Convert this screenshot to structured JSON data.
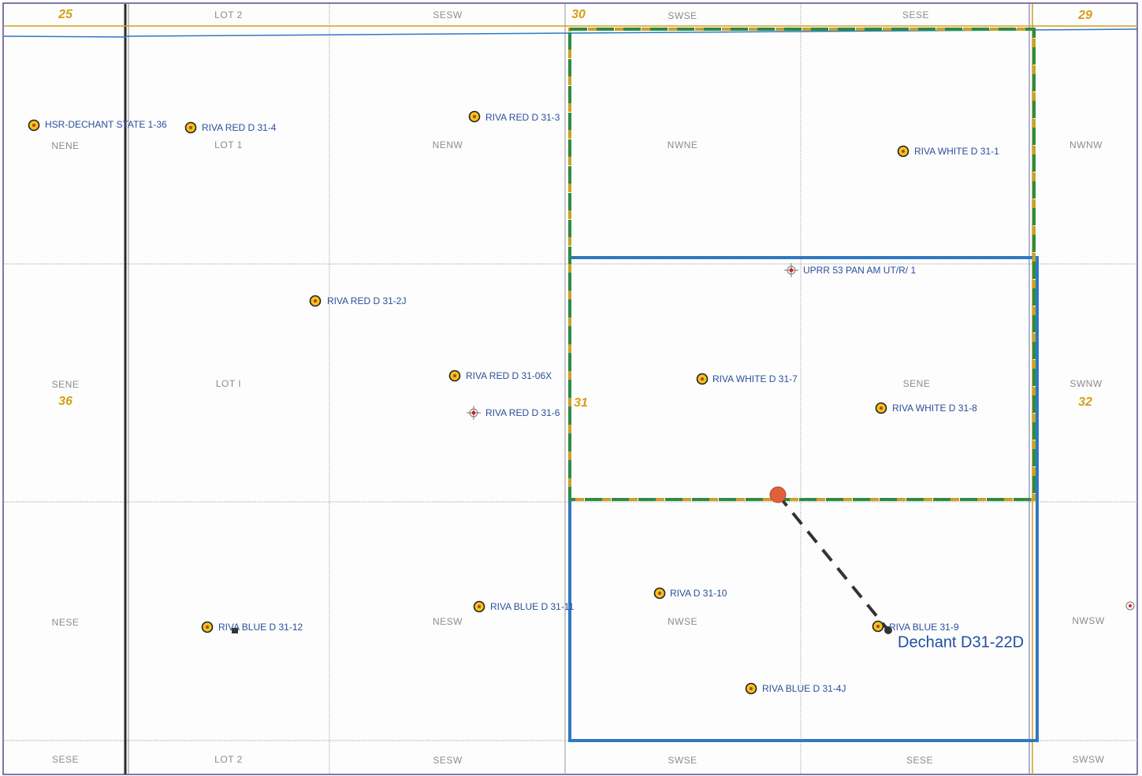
{
  "quarter_labels": {
    "sec25_nene": "NENE",
    "sec25_sene": "SENE",
    "sec25_nese": "NESE",
    "sec25_sese": "SESE",
    "col2_top": "LOT 2",
    "col2_r1": "LOT 1",
    "col2_r2": "LOT I",
    "col2_bottom": "LOT 2",
    "col3_top": "SESW",
    "col3_r1": "NENW",
    "col3_r3": "NESW",
    "col3_bottom": "SESW",
    "col4_top": "SWSE",
    "col4_r1": "NWNE",
    "col4_r3": "NWSE",
    "col4_bottom": "SWSE",
    "col5_top": "SESE",
    "col5_r2": "SENE",
    "col5_bottom": "SESE",
    "sec32_r1": "NWNW",
    "sec32_r2": "SWNW",
    "sec32_r3": "NWSW",
    "sec32_bottom": "SWSW"
  },
  "section_numbers": {
    "s25": "25",
    "s30": "30",
    "s29": "29",
    "s36": "36",
    "s31": "31",
    "s32": "32"
  },
  "wells": {
    "hsr_dechant": "HSR-DECHANT STATE 1-36",
    "riva_red_31_4": "RIVA RED D 31-4",
    "riva_red_31_3": "RIVA RED D 31-3",
    "riva_white_31_1": "RIVA WHITE D 31-1",
    "uprr_53": "UPRR 53 PAN AM UT/R/ 1",
    "riva_red_31_2j": "RIVA RED D 31-2J",
    "riva_red_31_06x": "RIVA RED D 31-06X",
    "riva_red_31_6": "RIVA RED D 31-6",
    "riva_white_31_7": "RIVA WHITE D 31-7",
    "riva_white_31_8": "RIVA WHITE D 31-8",
    "riva_d_31_10": "RIVA D 31-10",
    "riva_blue_31_11": "RIVA BLUE D 31-11",
    "riva_blue_31_12": "RIVA BLUE D 31-12",
    "riva_blue_31_9": "RIVA BLUE 31-9",
    "riva_blue_31_4j": "RIVA BLUE D 31-4J"
  },
  "proposed_well": {
    "label": "Dechant D31-22D"
  },
  "colors": {
    "section_number": "#d4a017",
    "well_label": "#2a4f9c",
    "spacing_unit_blue": "#2f78c4",
    "dashed_green": "#2e8b45",
    "dashed_gold": "#c9a227",
    "surface_location": "#e0603a",
    "wellbore_path": "#333333"
  },
  "icons": {
    "producing_well": "oil-well-icon",
    "permitted_location": "permitted-location-icon",
    "surface_hole": "surface-location-icon",
    "bottom_hole": "bottom-hole-icon"
  }
}
